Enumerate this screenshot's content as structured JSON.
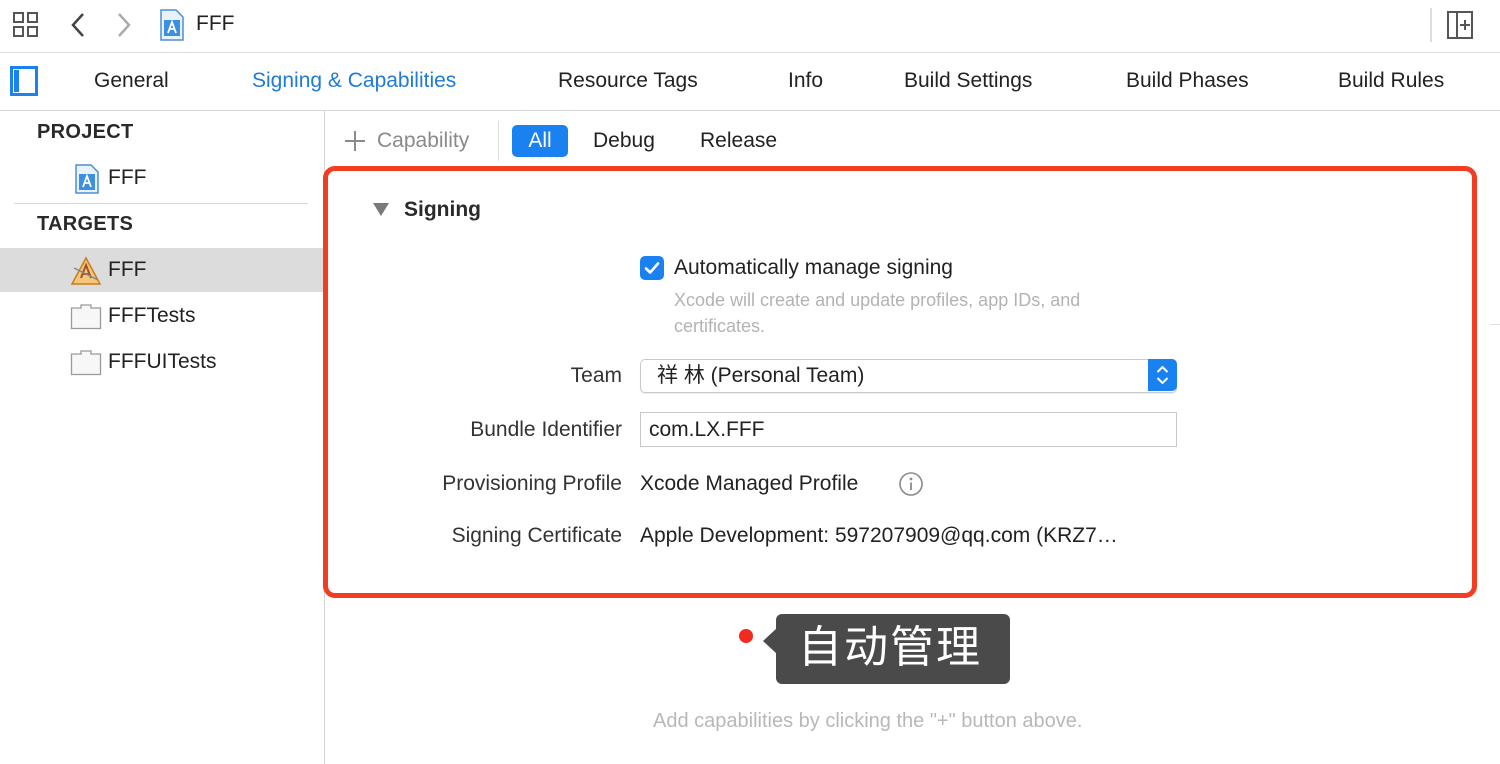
{
  "toolbar": {
    "title": "FFF",
    "icons": [
      "grid-icon",
      "chevron-left-icon",
      "chevron-right-icon",
      "project-file-icon",
      "add-editor-icon"
    ]
  },
  "tabs": {
    "items": [
      "General",
      "Signing & Capabilities",
      "Resource Tags",
      "Info",
      "Build Settings",
      "Build Phases",
      "Build Rules"
    ],
    "active": "Signing & Capabilities",
    "accent": "#1e7bd6"
  },
  "sidebar": {
    "project_header": "PROJECT",
    "project_item": "FFF",
    "targets_header": "TARGETS",
    "targets": [
      "FFF",
      "FFFTests",
      "FFFUITests"
    ]
  },
  "filter": {
    "add_capability": "Capability",
    "segments": [
      "All",
      "Debug",
      "Release"
    ],
    "selected": "All"
  },
  "signing": {
    "section_title": "Signing",
    "auto_manage_label": "Automatically manage signing",
    "auto_manage_checked": true,
    "auto_manage_hint_line1": "Xcode will create and update profiles, app IDs, and",
    "auto_manage_hint_line2": "certificates.",
    "team_label": "Team",
    "team_value": "祥 林 (Personal Team)",
    "bundle_label": "Bundle Identifier",
    "bundle_value": "com.LX.FFF",
    "profile_label": "Provisioning Profile",
    "profile_value": "Xcode Managed Profile",
    "certificate_label": "Signing Certificate",
    "certificate_value": "Apple Development: 597207909@qq.com (KRZ7…",
    "highlight_color": "#f33d22"
  },
  "tooltip": {
    "text": "自动管理"
  },
  "hint": "Add capabilities by clicking the \"+\" button above."
}
